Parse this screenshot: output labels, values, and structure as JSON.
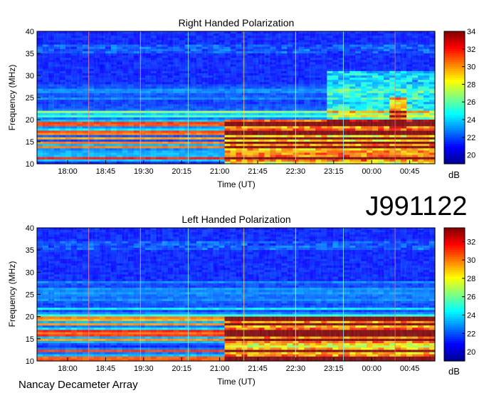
{
  "chart_data": [
    {
      "type": "heatmap",
      "title": "Right Handed Polarization",
      "xlabel": "Time (UT)",
      "ylabel": "Frequency (MHz)",
      "x_ticks": [
        "18:00",
        "18:45",
        "19:30",
        "20:15",
        "21:00",
        "21:45",
        "22:30",
        "23:15",
        "00:00",
        "00:45"
      ],
      "y_ticks": [
        10,
        15,
        20,
        25,
        30,
        35,
        40
      ],
      "ylim": [
        10,
        40
      ],
      "colorbar": {
        "label": "dB",
        "ticks": [
          20,
          22,
          24,
          26,
          28,
          30,
          32,
          34
        ],
        "range": [
          19,
          34
        ]
      }
    },
    {
      "type": "heatmap",
      "title": "Left Handed Polarization",
      "xlabel": "Time (UT)",
      "ylabel": "Frequency (MHz)",
      "x_ticks": [
        "18:00",
        "18:45",
        "19:30",
        "20:15",
        "21:00",
        "21:45",
        "22:30",
        "23:15",
        "00:00",
        "00:45"
      ],
      "y_ticks": [
        10,
        15,
        20,
        25,
        30,
        35,
        40
      ],
      "ylim": [
        10,
        40
      ],
      "colorbar": {
        "label": "dB",
        "ticks": [
          20,
          22,
          24,
          26,
          28,
          30,
          32
        ],
        "range": [
          19,
          33.5
        ]
      }
    }
  ],
  "annotations": {
    "observation_id": "J991122",
    "instrument": "Nancay Decameter Array"
  },
  "colors": {
    "colormap": [
      "#00008f",
      "#0000ff",
      "#0080ff",
      "#00ffff",
      "#80ff80",
      "#ffff00",
      "#ff8000",
      "#ff0000",
      "#800000"
    ]
  }
}
